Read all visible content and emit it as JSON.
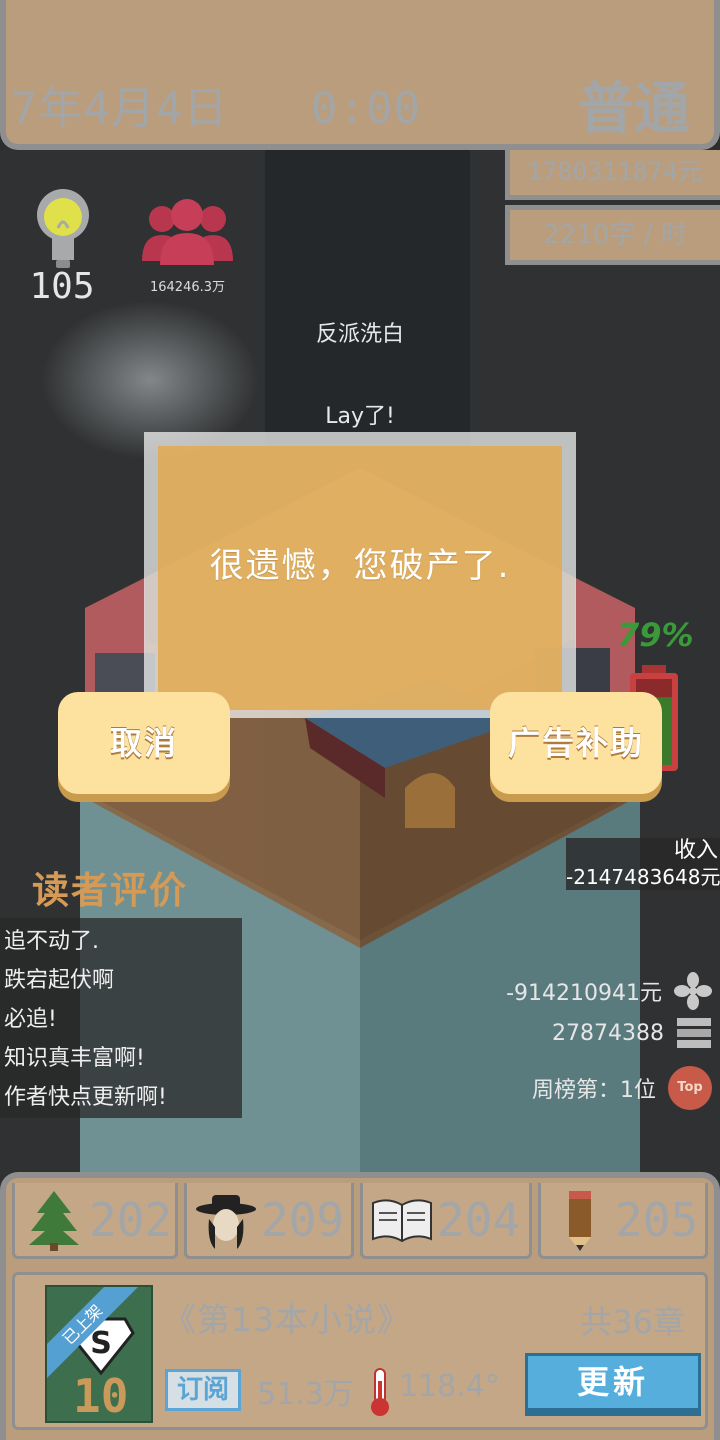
{
  "header": {
    "date": "7年4月4日",
    "time": "0:00",
    "mode": "普通"
  },
  "stats": {
    "money": "1780311874元",
    "speed": "2210字 / 时",
    "inspiration": "105",
    "fans": "164246.3万"
  },
  "news": {
    "line1": "反派洗白",
    "line2": "Lay了!"
  },
  "dialog": {
    "message": "很遗憾，您破产了.",
    "cancel_label": "取消",
    "ad_label": "广告补助"
  },
  "energy": {
    "percent_text": "79%",
    "level": 0.79
  },
  "reviews": {
    "title": "读者评价",
    "items": [
      "追不动了.",
      "跌宕起伏啊",
      "必追!",
      "知识真丰富啊!",
      "作者快点更新啊!"
    ]
  },
  "income": {
    "label": "收入",
    "value": "-2147483648元"
  },
  "side_stats": {
    "fan_money": "-914210941元",
    "stack_count": "27874388",
    "rank_text": "周榜第：1位",
    "top_badge": "Top"
  },
  "attributes": [
    {
      "icon": "tree-icon",
      "value": "202"
    },
    {
      "icon": "detective-icon",
      "value": "209"
    },
    {
      "icon": "book-icon",
      "value": "204"
    },
    {
      "icon": "pencil-icon",
      "value": "205"
    }
  ],
  "book": {
    "tag": "已上架",
    "level": "10",
    "title": "《第13本小说》",
    "chapters": "共36章",
    "subscribe_label": "订阅",
    "subscribers": "51.3万",
    "heat": "118.4°",
    "update_label": "更新"
  },
  "colors": {
    "panel": "#b99d7c",
    "dialog": "#e3a848",
    "button": "#fde29f",
    "update": "#56aedc",
    "reviews_title": "#d59a55"
  }
}
